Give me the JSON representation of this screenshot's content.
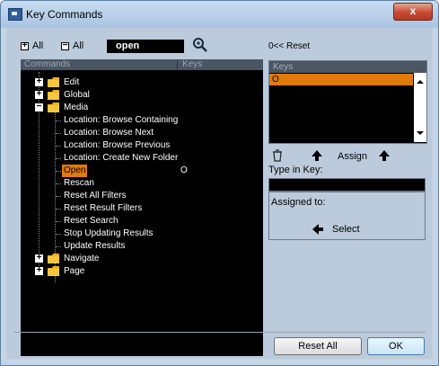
{
  "window": {
    "title": "Key Commands",
    "close_label": "x"
  },
  "toolbar": {
    "expand_all_glyph": "+",
    "expand_all_label": "All",
    "collapse_all_glyph": "−",
    "collapse_all_label": "All",
    "search_value": "open",
    "reset_label": "0<< Reset"
  },
  "tree": {
    "header_commands": "Commands",
    "header_keys": "Keys",
    "items": [
      {
        "label": "Edit",
        "type": "folder",
        "expander": "+"
      },
      {
        "label": "Global",
        "type": "folder",
        "expander": "+"
      },
      {
        "label": "Media",
        "type": "folder",
        "expander": "−"
      },
      {
        "label": "Location: Browse Containing",
        "type": "command"
      },
      {
        "label": "Location: Browse Next",
        "type": "command"
      },
      {
        "label": "Location: Browse Previous",
        "type": "command"
      },
      {
        "label": "Location: Create New Folder",
        "type": "command"
      },
      {
        "label": "Open",
        "type": "command",
        "key": "O",
        "selected": true
      },
      {
        "label": "Rescan",
        "type": "command"
      },
      {
        "label": "Reset All Filters",
        "type": "command"
      },
      {
        "label": "Reset Result Filters",
        "type": "command"
      },
      {
        "label": "Reset Search",
        "type": "command"
      },
      {
        "label": "Stop Updating Results",
        "type": "command"
      },
      {
        "label": "Update Results",
        "type": "command"
      },
      {
        "label": "Navigate",
        "type": "folder",
        "expander": "+"
      },
      {
        "label": "Page",
        "type": "folder",
        "expander": "+"
      }
    ]
  },
  "keys_panel": {
    "header": "Keys",
    "rows": [
      "O"
    ]
  },
  "assign": {
    "assign_label": "Assign",
    "type_in_label": "Type in Key:",
    "type_in_value": "",
    "assigned_to_label": "Assigned to:",
    "select_label": "Select"
  },
  "buttons": {
    "reset_all": "Reset All",
    "ok": "OK"
  },
  "colors": {
    "selection": "#e07a0a",
    "panel_bg": "#000000",
    "dialog_bg": "#bccbdc"
  }
}
